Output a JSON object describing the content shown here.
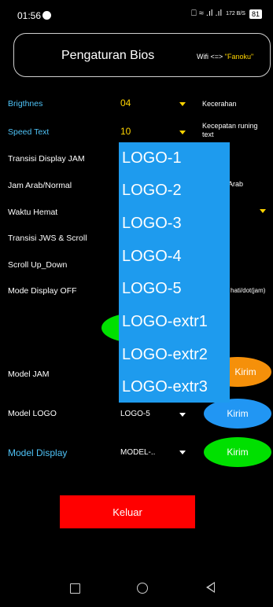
{
  "status_bar": {
    "time": "01:56",
    "icons": "⎕ ≈ .ıl .ıl",
    "net_speed": "172 B/S",
    "battery": "81"
  },
  "header": {
    "title": "Pengaturan Bios",
    "wifi_label": "Wifi <=>",
    "wifi_ssid": "\"Fanoku\""
  },
  "rows": [
    {
      "label": "Brigthnes",
      "value": "04",
      "desc": "Kecerahan"
    },
    {
      "label": "Speed Text",
      "value": "10",
      "desc": "Kecepatan runing text"
    },
    {
      "label": "Transisi Display JAM"
    },
    {
      "label": "Jam Arab/Normal",
      "desc_partial": "Arab"
    },
    {
      "label": "Waktu Hemat"
    },
    {
      "label": "Transisi JWS & Scroll"
    },
    {
      "label": "Scroll Up_Down"
    },
    {
      "label": "Mode Display OFF",
      "desc_partial": "hati/dot(jam)"
    },
    {
      "label": "Model JAM",
      "button": "Kirim"
    },
    {
      "label": "Model LOGO",
      "value": "LOGO-5",
      "button": "Kirim"
    },
    {
      "label": "Model Display",
      "value": "MODEL-..",
      "button": "Kirim"
    }
  ],
  "dropdown_options": [
    "LOGO-1",
    "LOGO-2",
    "LOGO-3",
    "LOGO-4",
    "LOGO-5",
    "LOGO-extr1",
    "LOGO-extr2",
    "LOGO-extr3"
  ],
  "exit_button": "Keluar",
  "colors": {
    "accent_yellow": "#ffd400",
    "label_blue": "#4fc3f7",
    "dropdown_bg": "#1e9bee",
    "kirim_orange": "#f5900a",
    "kirim_blue": "#2196f3",
    "kirim_green": "#00e000",
    "exit_red": "#ff0000"
  }
}
